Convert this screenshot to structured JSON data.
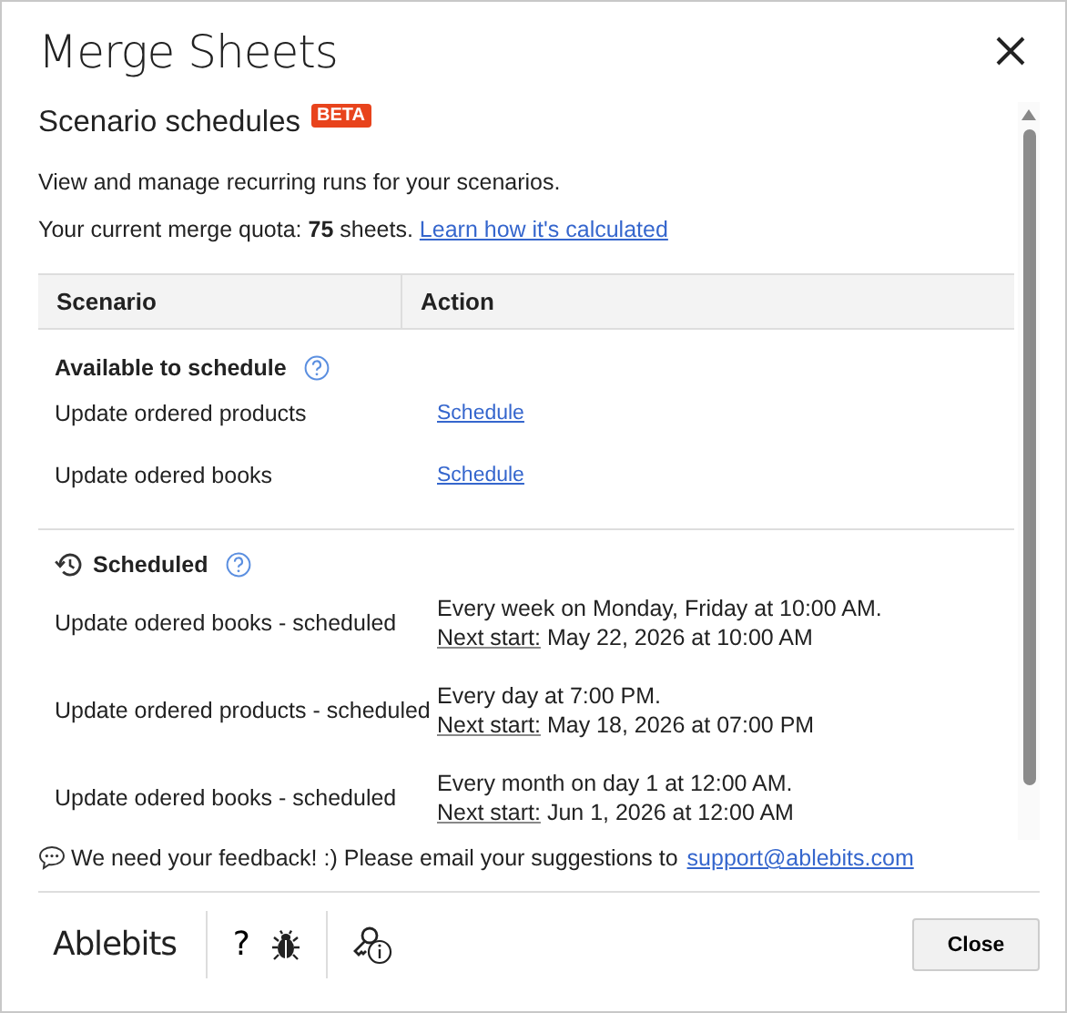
{
  "window": {
    "title": "Merge Sheets"
  },
  "section": {
    "title": "Scenario schedules",
    "badge": "BETA",
    "description": "View and manage recurring runs for your scenarios.",
    "quota_text": "Your current merge quota: **75** sheets.",
    "quota_link": "Learn how it's calculated"
  },
  "table": {
    "columns": [
      "Scenario",
      "Action"
    ],
    "groups": [
      {
        "kind": "available",
        "title": "Available to schedule",
        "rows": [
          {
            "scenario": "Update ordered products",
            "action": "Schedule"
          },
          {
            "scenario": "Update odered books",
            "action": "Schedule"
          }
        ]
      },
      {
        "kind": "scheduled",
        "title": "Scheduled",
        "rows": [
          {
            "scenario": "Update odered books - scheduled",
            "schedule": "Every week on Monday, Friday at 10:00 AM.",
            "next_label": "Next start:",
            "next_value": "May 22, 2026 at 10:00 AM"
          },
          {
            "scenario": "Update ordered products - scheduled",
            "schedule": "Every day at 7:00 PM.",
            "next_label": "Next start:",
            "next_value": "May 18, 2026 at 07:00 PM"
          },
          {
            "scenario": "Update odered books - scheduled",
            "schedule": "Every month on day 1 at 12:00 AM.",
            "next_label": "Next start:",
            "next_value": "Jun 1, 2026 at 12:00 AM"
          }
        ]
      }
    ]
  },
  "feedback": {
    "text": "We need your feedback! :) Please email your suggestions to",
    "link": "support@ablebits.com"
  },
  "footer": {
    "logo": "Ablebits",
    "help": "?",
    "button": "Close"
  }
}
